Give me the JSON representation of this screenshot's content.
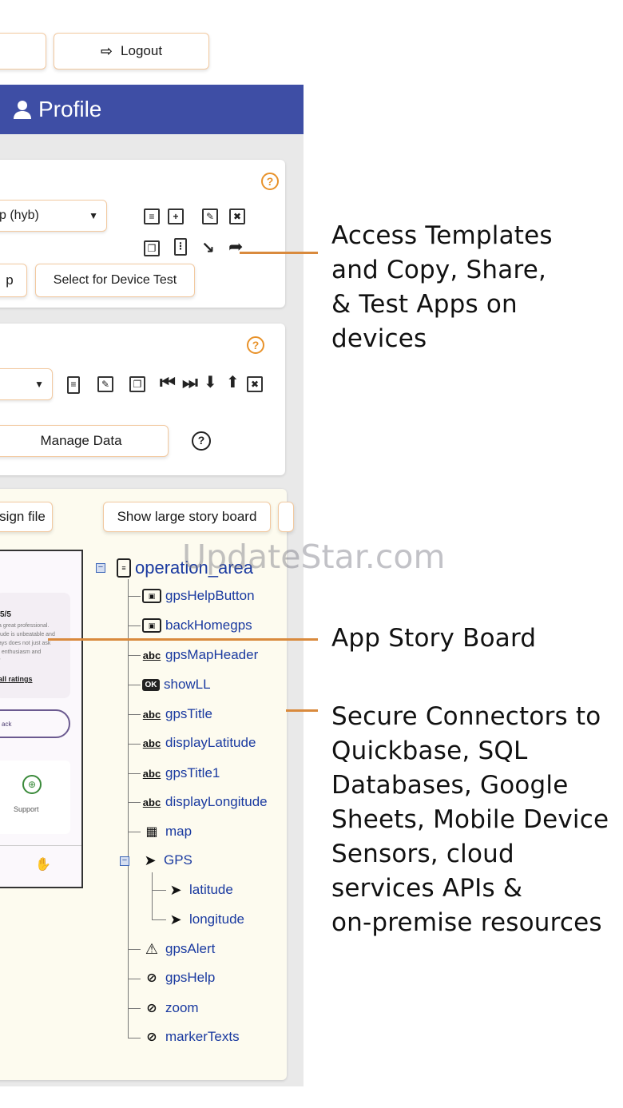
{
  "header": {
    "logout_label": "Logout",
    "logout_icon": "sign-out-icon",
    "profile_title": "Profile",
    "profile_icon": "user-icon",
    "profile_color": "#3e4ea5"
  },
  "app_panel": {
    "app_select_value": "p (hyb)",
    "button_left_label": "p",
    "device_test_label": "Select for Device Test",
    "help_symbol": "?"
  },
  "data_panel": {
    "manage_data_label": "Manage Data",
    "help_symbol": "?"
  },
  "storyboard": {
    "design_file_label": "sign file",
    "show_large_label": "Show large story board",
    "preview": {
      "rating": "5/5",
      "review_line1": "a great professional.",
      "review_line2": "tude is unbeatable and",
      "review_line3": "ays does not just ask",
      "review_line4": ", enthusiasm and",
      "review_line5": "\"",
      "all_ratings": "all ratings",
      "back_label": "ack",
      "support_label": "Support"
    },
    "tree": {
      "root": "operation_area",
      "nodes": [
        {
          "label": "gpsHelpButton",
          "icon": "button-icon"
        },
        {
          "label": "backHomegps",
          "icon": "button-icon"
        },
        {
          "label": "gpsMapHeader",
          "icon": "text-abc-icon"
        },
        {
          "label": "showLL",
          "icon": "ok-button-icon"
        },
        {
          "label": "gpsTitle",
          "icon": "text-abc-icon"
        },
        {
          "label": "displayLatitude",
          "icon": "text-abc-icon"
        },
        {
          "label": "gpsTitle1",
          "icon": "text-abc-icon"
        },
        {
          "label": "displayLongitude",
          "icon": "text-abc-icon"
        },
        {
          "label": "map",
          "icon": "map-icon"
        },
        {
          "label": "GPS",
          "icon": "location-arrow-icon"
        },
        {
          "label": "latitude",
          "icon": "location-arrow-icon"
        },
        {
          "label": "longitude",
          "icon": "location-arrow-icon"
        },
        {
          "label": "gpsAlert",
          "icon": "warning-icon"
        },
        {
          "label": "gpsHelp",
          "icon": "eye-slash-icon"
        },
        {
          "label": "zoom",
          "icon": "eye-slash-icon"
        },
        {
          "label": "markerTexts",
          "icon": "eye-slash-icon"
        }
      ]
    }
  },
  "annotations": {
    "templates_line1": "Access Templates",
    "templates_line2": "and Copy, Share,",
    "templates_line3": "& Test Apps on",
    "templates_line4": "devices",
    "storyboard": "App Story Board",
    "connectors_line1": "Secure Connectors to",
    "connectors_line2": "Quickbase, SQL",
    "connectors_line3": "Databases, Google",
    "connectors_line4": "Sheets, Mobile Device",
    "connectors_line5": "Sensors, cloud",
    "connectors_line6": "services APIs &",
    "connectors_line7": "on-premise resources",
    "accent_color": "#d98a3d"
  },
  "watermark": "UpdateStar.com"
}
